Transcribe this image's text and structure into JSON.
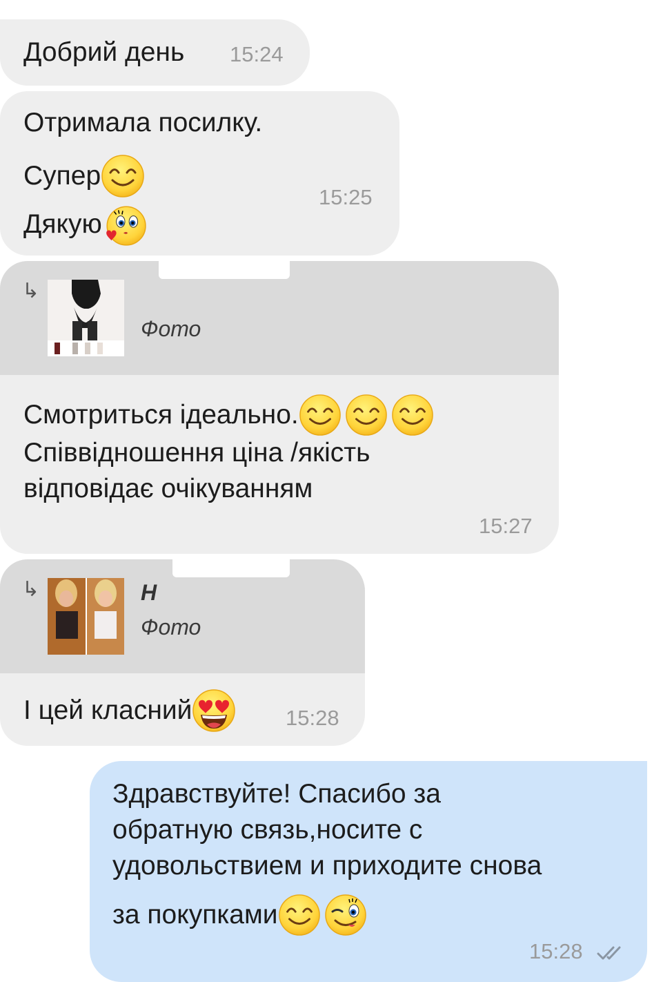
{
  "messages": [
    {
      "text": "Добрий день",
      "time": "15:24"
    },
    {
      "lines": [
        "Отримала посилку.",
        "Супер",
        "Дякую"
      ],
      "time": "15:25"
    },
    {
      "quote": {
        "author": "",
        "label": "Фото"
      },
      "lines": [
        "Смотриться ідеально.",
        "Співвідношення ціна /якість",
        "відповідає очікуванням"
      ],
      "time": "15:27"
    },
    {
      "quote": {
        "author": "Н",
        "label": "Фото"
      },
      "text": "І цей класний",
      "time": "15:28"
    },
    {
      "lines": [
        "Здравствуйте! Спасибо за",
        "обратную связь,носите с",
        "удовольствием и приходите снова",
        "за покупками"
      ],
      "time": "15:28",
      "status": "read"
    }
  ],
  "icons": {
    "reply": "reply-arrow-icon",
    "smile": "smiling-face-icon",
    "kiss": "kissing-face-icon",
    "heart_eyes": "heart-eyes-face-icon",
    "wink": "winking-face-icon",
    "read": "double-check-icon"
  },
  "colors": {
    "incoming": "#eeeeee",
    "quote": "#dadada",
    "outgoing": "#cfe4fa",
    "time": "#9a9a9a",
    "emoji": "#ffd43b"
  }
}
